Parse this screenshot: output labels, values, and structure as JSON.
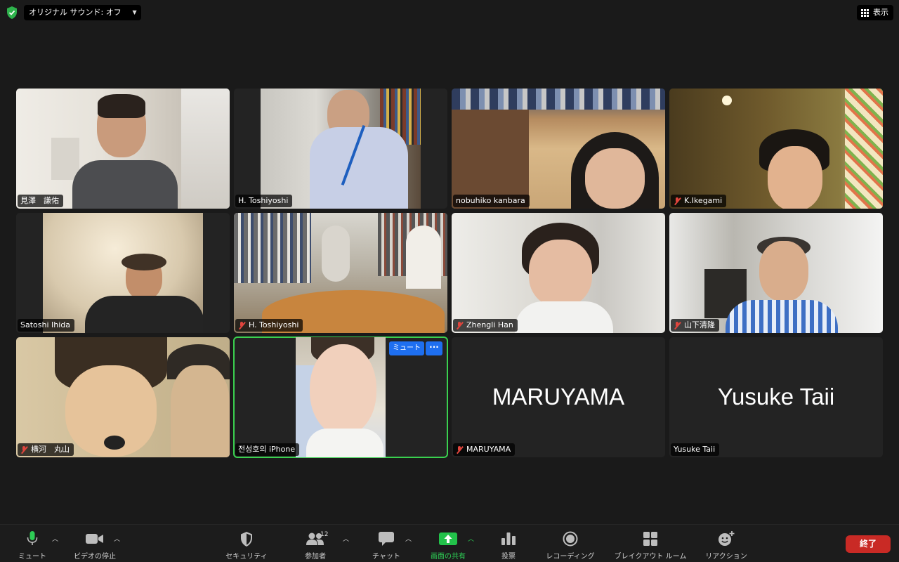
{
  "topbar": {
    "audio_label": "オリジナル サウンド: オフ",
    "view_label": "表示"
  },
  "participants": [
    {
      "name": "見澤　謙佑",
      "muted": false
    },
    {
      "name": "H. Toshiyoshi",
      "muted": false
    },
    {
      "name": "nobuhiko kanbara",
      "muted": false
    },
    {
      "name": "K.Ikegami",
      "muted": true
    },
    {
      "name": "Satoshi Ihida",
      "muted": false
    },
    {
      "name": "H. Toshiyoshi",
      "muted": true
    },
    {
      "name": "Zhengli Han",
      "muted": true
    },
    {
      "name": "山下清隆",
      "muted": true
    },
    {
      "name": "横河　丸山",
      "muted": true
    },
    {
      "name": "전성호의 iPhone",
      "muted": false,
      "active": true,
      "mute_button": "ミュート",
      "more_button": "···"
    },
    {
      "name": "MARUYAMA",
      "muted": true,
      "display_name": "MARUYAMA"
    },
    {
      "name": "Yusuke Taii",
      "muted": false,
      "display_name": "Yusuke Taii"
    }
  ],
  "toolbar": {
    "mute": "ミュート",
    "video": "ビデオの停止",
    "security": "セキュリティ",
    "participants": "参加者",
    "participant_count": "12",
    "chat": "チャット",
    "share": "画面の共有",
    "poll": "投票",
    "record": "レコーディング",
    "breakout": "ブレイクアウト ルーム",
    "reaction": "リアクション",
    "end": "終了"
  },
  "colors": {
    "share_green": "#22c24a",
    "end_red": "#c92a25",
    "active_border": "#3ad04f",
    "mute_blue": "#1e6ff0",
    "mic_off_red": "#e0453d"
  }
}
